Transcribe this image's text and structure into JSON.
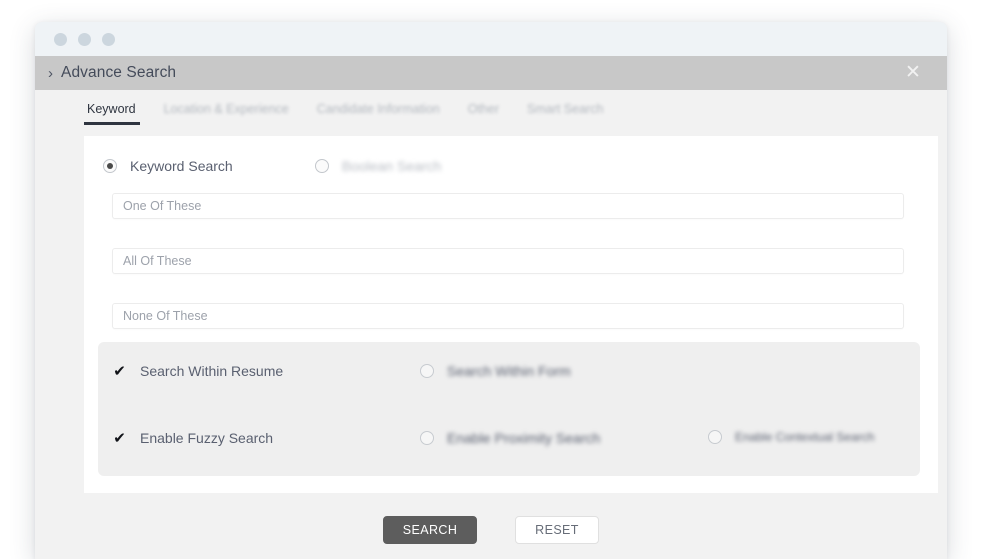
{
  "window": {
    "dots": [
      "window-dot-1",
      "window-dot-2",
      "window-dot-3"
    ],
    "chevron": "›",
    "title": "Advance Search",
    "close_icon": "✕"
  },
  "tabs": [
    {
      "label": "Keyword",
      "active": true,
      "blurred": false
    },
    {
      "label": "Location & Experience",
      "active": false,
      "blurred": true
    },
    {
      "label": "Candidate Information",
      "active": false,
      "blurred": true
    },
    {
      "label": "Other",
      "active": false,
      "blurred": true
    },
    {
      "label": "Smart Search",
      "active": false,
      "blurred": true
    }
  ],
  "search_mode": {
    "keyword": {
      "label": "Keyword Search",
      "selected": true
    },
    "boolean": {
      "label": "Boolean Search",
      "selected": false
    }
  },
  "fields": {
    "one_of_these": {
      "placeholder": "One Of These",
      "value": ""
    },
    "all_of_these": {
      "placeholder": "All Of These",
      "value": ""
    },
    "none_of_these": {
      "placeholder": "None Of These",
      "value": ""
    }
  },
  "options": {
    "search_within_resume": {
      "label": "Search Within Resume",
      "checked": true
    },
    "search_within_form": {
      "label": "Search Within Form",
      "checked": false
    },
    "enable_fuzzy_search": {
      "label": "Enable Fuzzy Search",
      "checked": true
    },
    "enable_proximity_search": {
      "label": "Enable Proximity Search",
      "checked": false
    },
    "enable_contextual_search": {
      "label": "Enable Contextual Search",
      "checked": false
    },
    "check_glyph": "✔"
  },
  "buttons": {
    "search": "SEARCH",
    "reset": "RESET"
  },
  "colors": {
    "header_bar": "#c8c8c8",
    "titlebar": "#eff3f6",
    "page_bg": "#f2f2f2",
    "panel_bg": "#efefef",
    "primary_button": "#5d5d5d",
    "active_tab": "#2f3540",
    "text": "#5a6070"
  }
}
